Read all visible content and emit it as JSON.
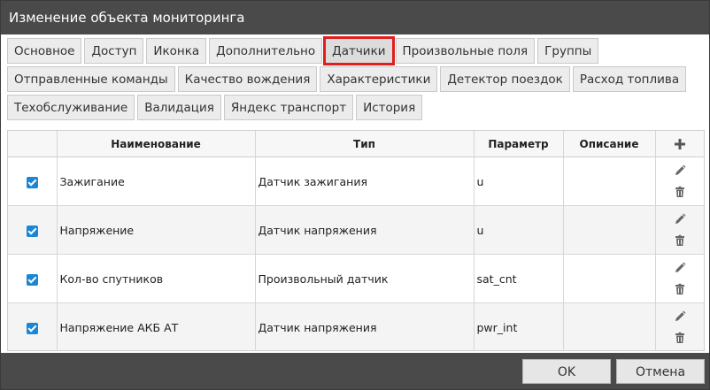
{
  "title": "Изменение объекта мониторинга",
  "tabs_row1": [
    "Основное",
    "Доступ",
    "Иконка",
    "Дополнительно",
    "Датчики",
    "Произвольные поля",
    "Группы"
  ],
  "tabs_row2": [
    "Отправленные команды",
    "Качество вождения",
    "Характеристики",
    "Детектор поездок",
    "Расход топлива"
  ],
  "tabs_row3": [
    "Техобслуживание",
    "Валидация",
    "Яндекс транспорт",
    "История"
  ],
  "active_tab": "Датчики",
  "table": {
    "headers": {
      "name": "Наименование",
      "type": "Тип",
      "param": "Параметр",
      "desc": "Описание"
    },
    "rows": [
      {
        "checked": true,
        "name": "Зажигание",
        "type": "Датчик зажигания",
        "param": "u",
        "desc": ""
      },
      {
        "checked": true,
        "name": "Напряжение",
        "type": "Датчик напряжения",
        "param": "u",
        "desc": ""
      },
      {
        "checked": true,
        "name": "Кол-во спутников",
        "type": "Произвольный датчик",
        "param": "sat_cnt",
        "desc": ""
      },
      {
        "checked": true,
        "name": "Напряжение АКБ АТ",
        "type": "Датчик напряжения",
        "param": "pwr_int",
        "desc": ""
      }
    ]
  },
  "icons": {
    "add": "plus-icon",
    "edit": "pencil-icon",
    "delete": "trash-icon",
    "check": "checkbox-checked-icon"
  },
  "colors": {
    "titlebar": "#4a4a4a",
    "checkbox": "#1a86d4",
    "active_tab_outline": "#e01d1d"
  },
  "buttons": {
    "ok": "OK",
    "cancel": "Отмена"
  }
}
